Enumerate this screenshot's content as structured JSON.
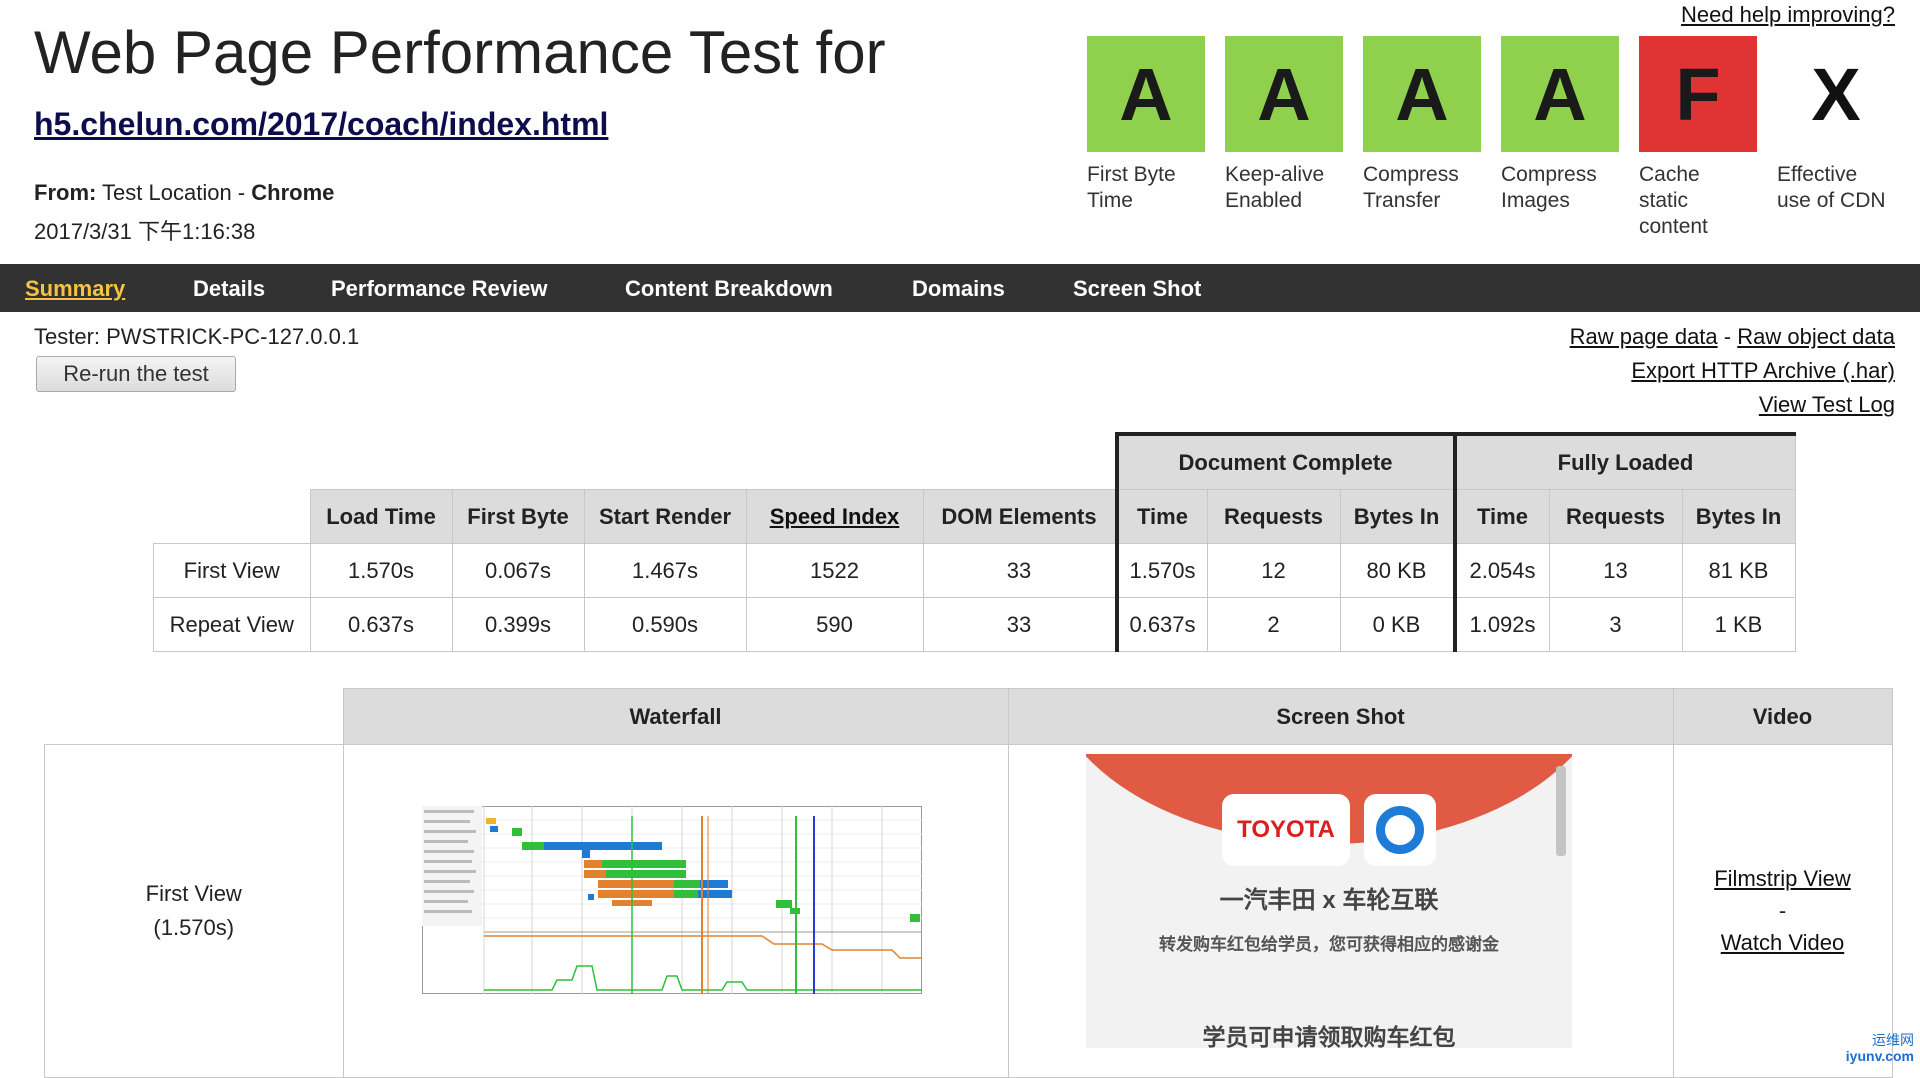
{
  "header": {
    "title": "Web Page Performance Test for",
    "url": "h5.chelun.com/2017/coach/index.html",
    "from_label": "From:",
    "from_location": "Test Location -",
    "from_browser": "Chrome",
    "date": "2017/3/31 下午1:16:38",
    "help_link": "Need help improving?"
  },
  "grades": [
    {
      "grade": "A",
      "label1": "First Byte",
      "label2": "Time",
      "label3": "",
      "color": "#8fd04c"
    },
    {
      "grade": "A",
      "label1": "Keep-alive",
      "label2": "Enabled",
      "label3": "",
      "color": "#8fd04c"
    },
    {
      "grade": "A",
      "label1": "Compress",
      "label2": "Transfer",
      "label3": "",
      "color": "#8fd04c"
    },
    {
      "grade": "A",
      "label1": "Compress",
      "label2": "Images",
      "label3": "",
      "color": "#8fd04c"
    },
    {
      "grade": "F",
      "label1": "Cache",
      "label2": "static",
      "label3": "content",
      "color": "#e03434"
    },
    {
      "grade": "X",
      "label1": "Effective",
      "label2": "use of CDN",
      "label3": "",
      "color": "none"
    }
  ],
  "nav": {
    "summary": "Summary",
    "details": "Details",
    "performance_review": "Performance Review",
    "content_breakdown": "Content Breakdown",
    "domains": "Domains",
    "screen_shot": "Screen Shot",
    "active_color": "#f5c242"
  },
  "tester": "Tester: PWSTRICK-PC-127.0.0.1",
  "rerun": "Re-run the test",
  "links": {
    "raw_page": "Raw page data",
    "sep": "-",
    "raw_object": "Raw object data",
    "har": "Export HTTP Archive (.har)",
    "log": "View Test Log"
  },
  "summary_table": {
    "group_doc": "Document Complete",
    "group_full": "Fully Loaded",
    "headers": [
      "Load Time",
      "First Byte",
      "Start Render",
      "Speed Index",
      "DOM Elements",
      "Time",
      "Requests",
      "Bytes In",
      "Time",
      "Requests",
      "Bytes In"
    ],
    "rows": [
      {
        "label": "First View",
        "values": [
          "1.570s",
          "0.067s",
          "1.467s",
          "1522",
          "33",
          "1.570s",
          "12",
          "80 KB",
          "2.054s",
          "13",
          "81 KB"
        ]
      },
      {
        "label": "Repeat View",
        "values": [
          "0.637s",
          "0.399s",
          "0.590s",
          "590",
          "33",
          "0.637s",
          "2",
          "0 KB",
          "1.092s",
          "3",
          "1 KB"
        ]
      }
    ]
  },
  "lower_table": {
    "headers": [
      "Waterfall",
      "Screen Shot",
      "Video"
    ],
    "row_label": "First View",
    "row_time": "(1.570s)",
    "filmstrip": "Filmstrip View",
    "dash": "-",
    "watch": "Watch Video"
  },
  "screenshot_mock": {
    "logo_text": "TOYOTA",
    "line1": "一汽丰田 x 车轮互联",
    "line2": "转发购车红包给学员，您可获得相应的感谢金",
    "line3": "学员可申请领取购车红包"
  },
  "watermark": {
    "line1": "运维网",
    "line2": "iyunv.com"
  }
}
